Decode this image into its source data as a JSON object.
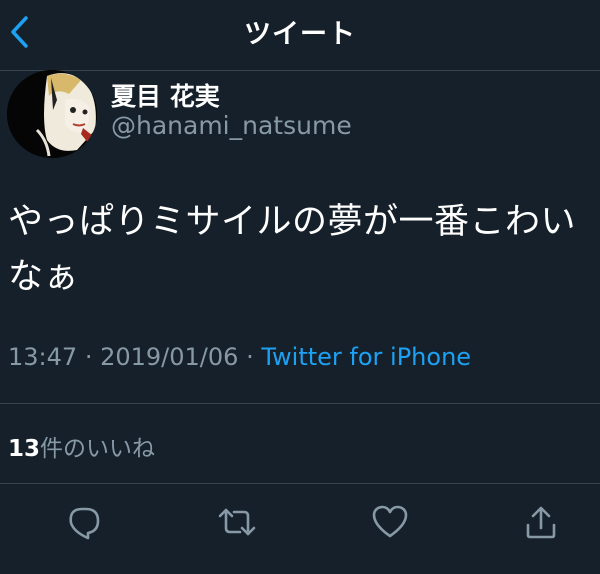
{
  "header": {
    "title": "ツイート"
  },
  "tweet": {
    "display_name": "夏目 花実",
    "handle": "@hanami_natsume",
    "text": "やっぱりミサイルの夢が一番こわいなぁ",
    "time": "13:47",
    "separator": "·",
    "date": "2019/01/06",
    "source": "Twitter for iPhone"
  },
  "stats": {
    "likes_count": "13",
    "likes_label": "件のいいね"
  },
  "actions": [
    "reply-icon",
    "retweet-icon",
    "like-icon",
    "share-icon"
  ],
  "colors": {
    "background": "#15202b",
    "accent": "#1da1f2",
    "muted": "#8899a6",
    "divider": "#38444d"
  }
}
